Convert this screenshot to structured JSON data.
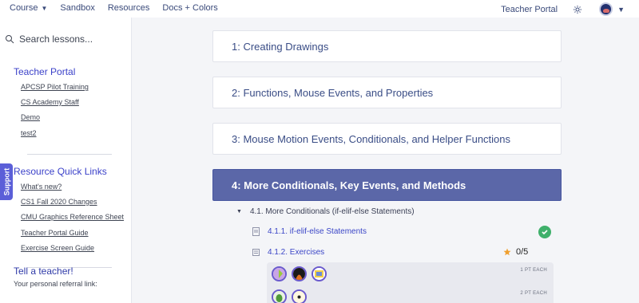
{
  "topbar": {
    "nav": [
      {
        "label": "Course",
        "has_caret": true
      },
      {
        "label": "Sandbox"
      },
      {
        "label": "Resources"
      },
      {
        "label": "Docs + Colors"
      }
    ],
    "teacher_portal": "Teacher Portal",
    "gear_icon": "gear-icon",
    "avatar_caret": "▼"
  },
  "sidebar": {
    "search_placeholder": "Search lessons...",
    "teacher_portal": {
      "title": "Teacher Portal",
      "links": [
        "APCSP Pilot Training",
        "CS Academy Staff",
        "Demo",
        "test2"
      ]
    },
    "quick_links": {
      "title": "Resource Quick Links",
      "links": [
        "What's new?",
        "CS1 Fall 2020 Changes",
        "CMU Graphics Reference Sheet",
        "Teacher Portal Guide",
        "Exercise Screen Guide"
      ]
    },
    "tell": {
      "title": "Tell a teacher!",
      "subtitle": "Your personal referral link:"
    },
    "support_label": "Support"
  },
  "main": {
    "units": [
      {
        "label": "1: Creating Drawings"
      },
      {
        "label": "2: Functions, Mouse Events, and Properties"
      },
      {
        "label": "3: Mouse Motion Events, Conditionals, and Helper Functions"
      },
      {
        "label": "4: More Conditionals, Key Events, and Methods",
        "active": true
      }
    ],
    "section": "4.1. More Conditionals (if-elif-else Statements)",
    "lessons": [
      {
        "label": "4.1.1. if-elif-else Statements",
        "completed": true
      },
      {
        "label": "4.1.2. Exercises",
        "score": "0/5"
      }
    ],
    "exercise_groups": [
      {
        "label": "1 PT EACH"
      },
      {
        "label": "2 PT EACH"
      }
    ],
    "colors": {
      "accent": "#5b67a8",
      "link": "#3b46c7",
      "success": "#3fb06b",
      "star": "#f0a030"
    }
  }
}
